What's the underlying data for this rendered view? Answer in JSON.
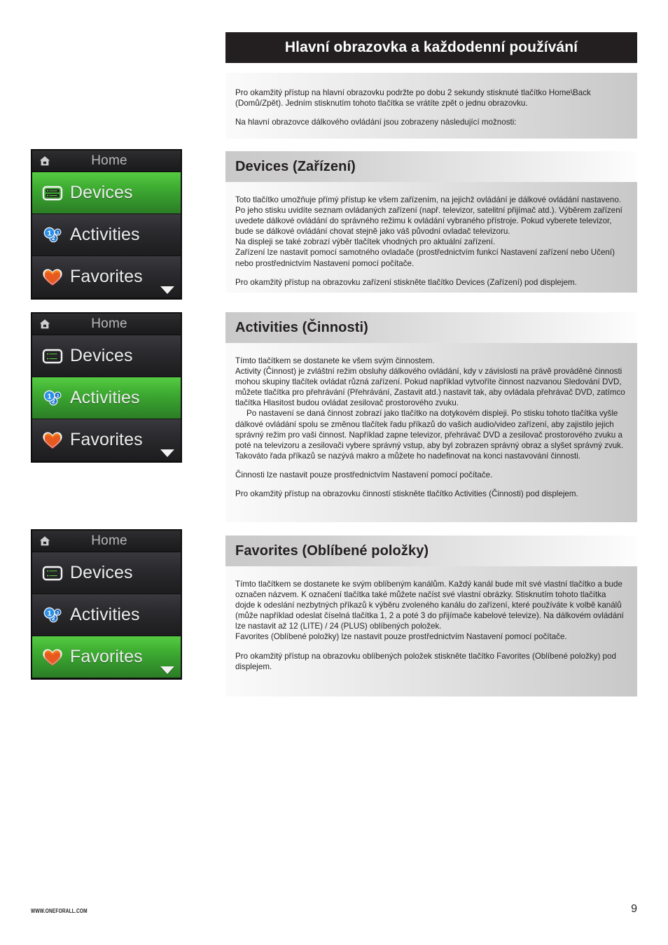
{
  "header": {
    "title": "Hlavní obrazovka a každodenní používání"
  },
  "intro": {
    "paragraph_1": "Pro okamžitý přístup na hlavní obrazovku podržte po dobu 2 sekundy stisknuté tlačítko Home\\Back (Domů/Zpět). Jedním stisknutím tohoto tlačítka se vrátíte zpět o jednu obrazovku.",
    "paragraph_2": "Na hlavní obrazovce dálkového ovládání jsou zobrazeny následující možnosti:"
  },
  "sections": {
    "devices": {
      "heading": "Devices (Zařízení)",
      "paragraph_1": "Toto tlačítko umožňuje přímý přístup ke všem zařízením, na jejichž ovládání je dálkové ovládání nastaveno.  Po jeho stisku uvidíte seznam ovládaných zařízení (např. televizor, satelitní přijímač atd.). Výběrem zařízení uvedete dálkové ovládání do správného režimu k ovládání vybraného přístroje.  Pokud vyberete televizor, bude se dálkové ovládání chovat stejně jako váš původní ovladač televizoru.",
      "paragraph_2": "Na displeji se také zobrazí výběr tlačítek vhodných pro aktuální zařízení.",
      "paragraph_3": "Zařízení lze nastavit pomocí samotného ovladače (prostřednictvím funkcí Nastavení zařízení nebo Učení) nebo prostřednictvím Nastavení pomocí počítače.",
      "paragraph_4": "Pro okamžitý přístup na obrazovku zařízení stiskněte tlačítko Devices (Zařízení) pod displejem."
    },
    "activities": {
      "heading": "Activities (Činnosti)",
      "paragraph_1": "Tímto tlačítkem se dostanete ke všem svým činnostem.",
      "paragraph_2": "Activity (Činnost) je zvláštní režim obsluhy dálkového ovládání, kdy v závislosti na právě prováděné činnosti mohou skupiny tlačítek ovládat různá zařízení. Pokud například vytvoříte činnost nazvanou Sledování DVD, můžete tlačítka pro přehrávání (Přehrávání, Zastavit atd.) nastavit tak, aby ovládala přehrávač DVD, zatímco tlačítka Hlasitost budou ovládat zesilovač prostorového zvuku.",
      "paragraph_3": "Po nastavení se daná činnost zobrazí jako tlačítko na dotykovém displeji. Po stisku tohoto tlačítka vyšle dálkové ovládání spolu se změnou tlačítek řadu příkazů do vašich audio/video zařízení, aby zajistilo jejich správný režim pro vaši činnost. Například zapne televizor, přehrávač DVD a zesilovač prostorového zvuku a poté na televizoru a zesilovači vybere správný vstup, aby byl zobrazen správný obraz a slyšet správný zvuk. Takováto řada příkazů se nazývá makro a můžete ho nadefinovat na konci nastavování činnosti.",
      "paragraph_4": "Činnosti lze nastavit pouze prostřednictvím Nastavení pomocí počítače.",
      "paragraph_5": "Pro okamžitý přístup na obrazovku činností stiskněte tlačítko Activities (Činnosti) pod displejem."
    },
    "favorites": {
      "heading": "Favorites (Oblíbené položky)",
      "paragraph_1": "Tímto tlačítkem se dostanete ke svým oblíbeným kanálům. Každý kanál bude mít své vlastní tlačítko a bude označen názvem. K označení tlačítka také můžete načíst své vlastní obrázky. Stisknutím tohoto tlačítka dojde k odeslání nezbytných příkazů k výběru zvoleného kanálu do zařízení, které používáte k volbě kanálů (může například odeslat číselná tlačítka 1, 2 a poté 3 do přijímače kabelové televize). Na dálkovém ovládání lze nastavit až 12 (LITE) / 24 (PLUS) oblíbených položek.",
      "paragraph_2": "Favorites (Oblíbené položky) lze nastavit pouze prostřednictvím Nastavení pomocí počítače.",
      "paragraph_3": "Pro okamžitý přístup na obrazovku oblíbených položek stiskněte tlačítko Favorites (Oblíbené položky) pod displejem."
    }
  },
  "remote_screens": {
    "home_label": "Home",
    "menu": {
      "devices": "Devices",
      "activities": "Activities",
      "favorites": "Favorites"
    },
    "screen_1_selected": "Devices",
    "screen_2_selected": "Activities",
    "screen_3_selected": "Favorites",
    "colors": {
      "selected_green_top": "#55cb41",
      "selected_green_bottom": "#2b7d25",
      "row_dark_top": "#3a3a3e",
      "row_dark_bottom": "#1d1d20",
      "screen_bezel": "#0e0e0e",
      "label_text": "#eceded",
      "home_bar_text": "#b9b9bb"
    }
  },
  "footer": {
    "url": "WWW.ONEFORALL.COM",
    "page_number": "9"
  }
}
